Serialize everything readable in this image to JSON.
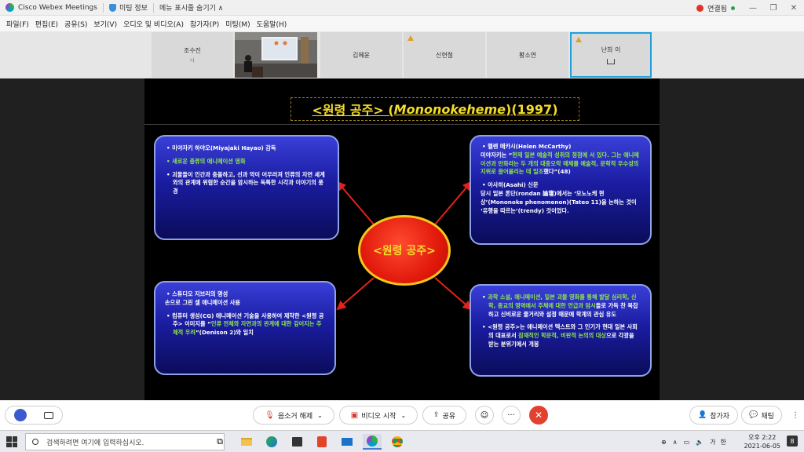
{
  "titlebar": {
    "app_name": "Cisco Webex Meetings",
    "meeting_info": "미팅 정보",
    "hide_menu": "메뉴 표시줄 숨기기 ∧",
    "status": "연결됨",
    "window_buttons": [
      "—",
      "❐",
      "✕"
    ]
  },
  "menu": {
    "items": [
      "파일(F)",
      "편집(E)",
      "공유(S)",
      "보기(V)",
      "오디오 및 비디오(A)",
      "참가자(P)",
      "미팅(M)",
      "도움말(H)"
    ]
  },
  "participants": [
    {
      "name": "조수진",
      "sub": "나",
      "warn": false,
      "active": false
    },
    {
      "name": "김혜윤",
      "sub": "",
      "warn": false,
      "active": false
    },
    {
      "name": "신현철",
      "sub": "",
      "warn": true,
      "active": false
    },
    {
      "name": "황소연",
      "sub": "",
      "warn": false,
      "active": false
    },
    {
      "name": "난희 이",
      "sub": "",
      "warn": true,
      "active": true
    }
  ],
  "slide": {
    "title_prefix": "<원령 공주> (",
    "title_italic": "Mononokeheme",
    "title_suffix": ")(1997)",
    "center": "<원령 공주>",
    "box1": {
      "b1": "미야자키 하야오(Miyajaki Hayao) 감독",
      "b2": "새로운 종류의 애니메이션 영화",
      "b3": "괴물들이 인간과 충돌하고, 선과 악이 어우러져 인류의 자연 세계와의 관계에 위협한 순간을 암시하는 독특한 시각과 이야기의 풍경"
    },
    "box2": {
      "b1": "헬렌 매카시(Helen McCarthy)",
      "p1a": "미야자키는 “",
      "p1g": "현재 일본 예술적 성취의 정점에 서 있다. 그는 애니메이션과 만화라는 두 개의 대중오락 매체를 예술적, 문학적 우수성의 지위로 끌어올리는 데 일조",
      "p1b": "했다”(48)",
      "b2": "아사히(Asahi) 신문",
      "p2": "당시 일본 론단(rondan 論壇)에서는 ‘모노노케 현상’(Mononoke phenomenon)(Tateo 11)을 논하는 것이 ‘유행을 따르는’(trendy) 것이었다."
    },
    "box3": {
      "b1": "스튜디오 지브리의 명성",
      "l1": "손으로 그린 셀 애니메이션 사용",
      "b2a": "컴퓨터 생성(CG) 애니메이션 기술을 사용하여 제작한 <원령 공주> 이미지를 “",
      "b2g": "인류 전체와 자연과의 관계에 대한 깊어지는 주체적 우려",
      "b2b": "”(Denison 2)와 일치"
    },
    "box4": {
      "b1g": "과학 소설, 애니메이션, 일본 괴물 영화를 통해 발달 심리학, 신학, 종교의 영역에서 주체에 대한 언급과 암시",
      "b1b": "들로 가득 찬 복잡하고 신비로운 줄거리와 설정 때문에 학계의 관심 유도",
      "b2a": "<원령 공주>는 애니메이션 텍스트와 그 인기가 현대 일본 사회의 대표로서 ",
      "b2g": "잠재적인 학문적, 비판적 논의의 대상",
      "b2b": "으로 각광을 받는 분위기에서 개봉"
    }
  },
  "controls": {
    "mute": "음소거 해제",
    "video": "비디오 시작",
    "share": "공유",
    "more": "···",
    "participants": "참가자",
    "chat": "채팅"
  },
  "taskbar": {
    "search_placeholder": "검색하려면 여기에 입력하십시오.",
    "time": "오후 2:22",
    "date": "2021-06-05",
    "ime": "가",
    "lang": "한",
    "notif_count": "8"
  }
}
